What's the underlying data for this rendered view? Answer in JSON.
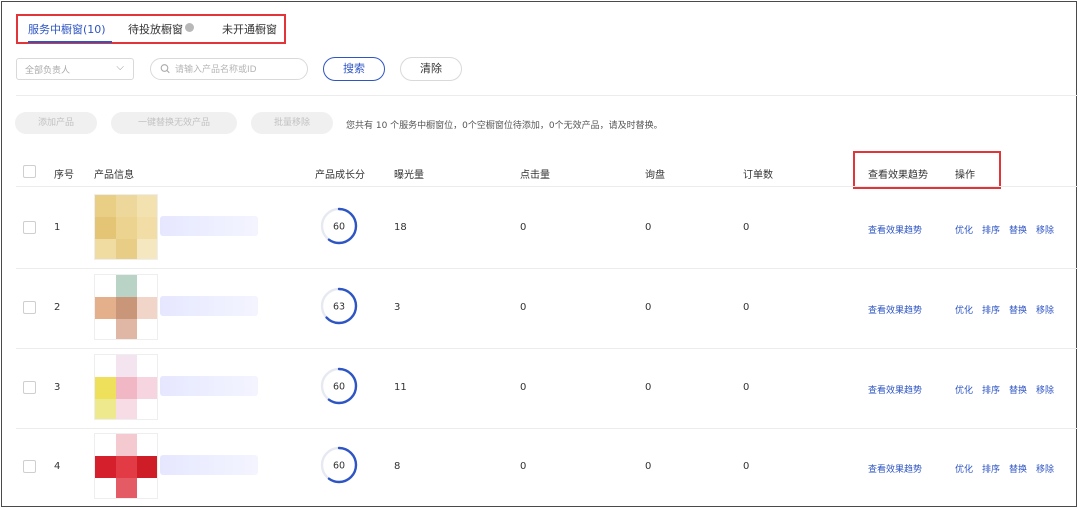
{
  "tabs": [
    {
      "label": "服务中橱窗",
      "count": "(10)"
    },
    {
      "label": "待投放橱窗"
    },
    {
      "label": "未开通橱窗"
    }
  ],
  "filters": {
    "owner_select": "全部负责人",
    "search_placeholder": "请输入产品名称或ID",
    "search_button": "搜索",
    "clear_button": "清除"
  },
  "actions": {
    "add_product": "添加产品",
    "replace_invalid": "一键替换无效产品",
    "batch_remove": "批量移除",
    "notice": "您共有 10 个服务中橱窗位，0个空橱窗位待添加，0个无效产品，请及时替换。"
  },
  "table": {
    "headers": {
      "index": "序号",
      "product_info": "产品信息",
      "growth_score": "产品成长分",
      "impressions": "曝光量",
      "clicks": "点击量",
      "inquiries": "询盘",
      "orders": "订单数",
      "trend": "查看效果趋势",
      "operation": "操作"
    },
    "row_links": {
      "trend": "查看效果趋势",
      "optimize": "优化",
      "sort": "排序",
      "replace": "替换",
      "remove": "移除"
    },
    "rows": [
      {
        "index": "1",
        "score": 60,
        "impressions": "18",
        "clicks": "0",
        "inquiries": "0",
        "orders": "0"
      },
      {
        "index": "2",
        "score": 63,
        "impressions": "3",
        "clicks": "0",
        "inquiries": "0",
        "orders": "0"
      },
      {
        "index": "3",
        "score": 60,
        "impressions": "11",
        "clicks": "0",
        "inquiries": "0",
        "orders": "0"
      },
      {
        "index": "4",
        "score": 60,
        "impressions": "8",
        "clicks": "0",
        "inquiries": "0",
        "orders": "0"
      }
    ]
  },
  "colors": {
    "accent": "#2e55c4",
    "highlight": "#e1353a"
  }
}
